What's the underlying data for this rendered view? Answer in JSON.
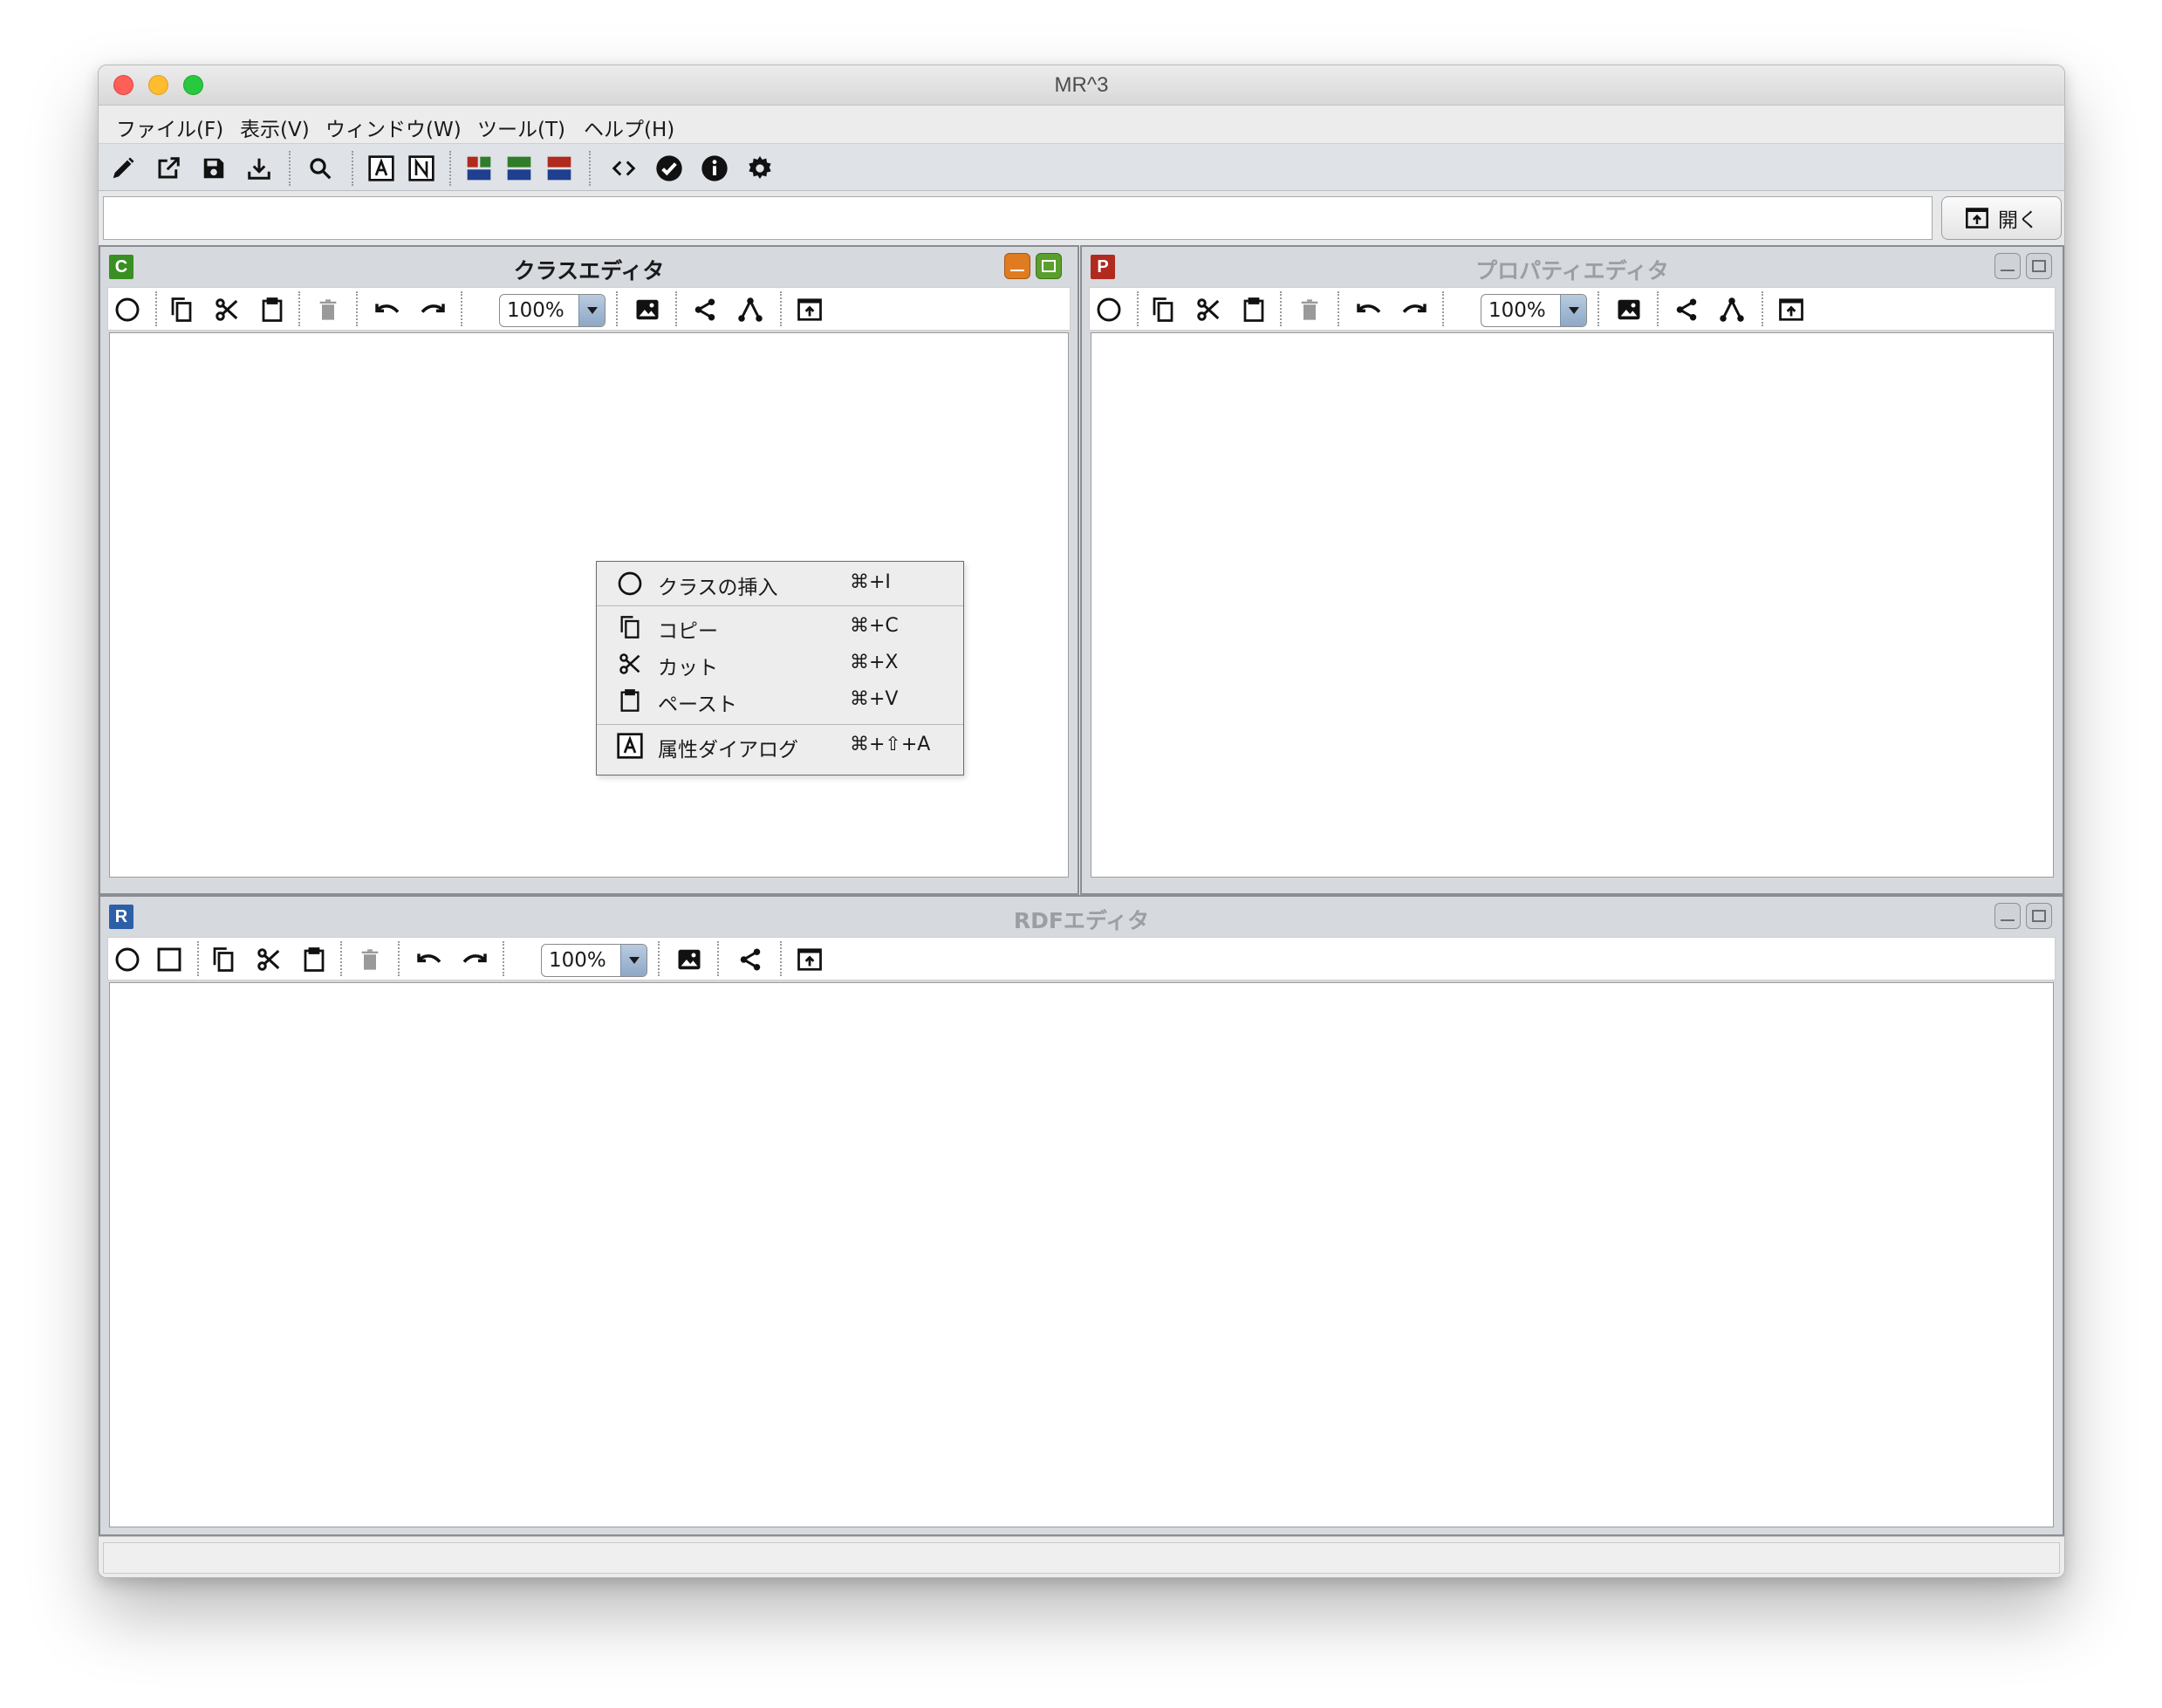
{
  "window": {
    "title": "MR^3"
  },
  "menubar": {
    "items": [
      "ファイル(F)",
      "表示(V)",
      "ウィンドウ(W)",
      "ツール(T)",
      "ヘルプ(H)"
    ]
  },
  "toolbar": {
    "icons": [
      "pencil-icon",
      "open-external-icon",
      "save-icon",
      "download-icon",
      "search-icon",
      "box-a-icon",
      "box-n-icon",
      "layout-1-icon",
      "layout-2-icon",
      "layout-3-icon",
      "code-icon",
      "check-circle-icon",
      "info-icon",
      "gear-icon"
    ],
    "box_a_label": "A",
    "box_n_label": "N"
  },
  "url_bar": {
    "value": "",
    "placeholder": "",
    "open_label": "開く"
  },
  "class_editor": {
    "badge": "C",
    "title": "クラスエディタ",
    "zoom": "100%",
    "badge_color": "#3a8f22",
    "active": true
  },
  "property_editor": {
    "badge": "P",
    "title": "プロパティエディタ",
    "zoom": "100%",
    "badge_color": "#b02a1e",
    "active": false
  },
  "rdf_editor": {
    "badge": "R",
    "title": "RDFエディタ",
    "zoom": "100%",
    "badge_color": "#2c5fa8",
    "active": false
  },
  "context_menu": {
    "items": [
      {
        "icon": "circle-icon",
        "label": "クラスの挿入",
        "shortcut": "⌘+I"
      },
      {
        "icon": "copy-icon",
        "label": "コピー",
        "shortcut": "⌘+C"
      },
      {
        "icon": "scissors-icon",
        "label": "カット",
        "shortcut": "⌘+X"
      },
      {
        "icon": "paste-icon",
        "label": "ペースト",
        "shortcut": "⌘+V"
      },
      {
        "icon": "box-a-icon",
        "label": "属性ダイアログ",
        "shortcut": "⌘+⇧+A",
        "icon_text": "A"
      }
    ]
  },
  "status": {
    "text": ""
  }
}
